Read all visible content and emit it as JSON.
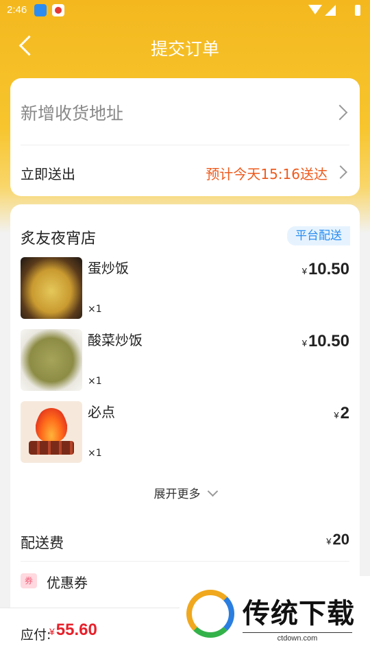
{
  "status_bar": {
    "time": "2:46"
  },
  "header": {
    "title": "提交订单"
  },
  "address_card": {
    "add_address_label": "新增收货地址",
    "delivery_mode_label": "立即送出",
    "delivery_estimate": "预计今天15:16送达"
  },
  "order": {
    "shop_name": "炙友夜宵店",
    "delivery_tag": "平台配送",
    "currency": "¥",
    "items": [
      {
        "name": "蛋炒饭",
        "qty": "×1",
        "price": "10.50"
      },
      {
        "name": "酸菜炒饭",
        "qty": "×1",
        "price": "10.50"
      },
      {
        "name": "必点",
        "qty": "×1",
        "price": "2"
      }
    ],
    "expand_label": "展开更多",
    "delivery_fee_label": "配送费",
    "delivery_fee": "20",
    "coupon_icon_text": "券",
    "coupon_label": "优惠券"
  },
  "footer": {
    "payable_label": "应付:",
    "payable_amount": "55.60"
  },
  "watermark": {
    "title": "传统下载",
    "site": "ctdown.com"
  },
  "colors": {
    "primary": "#f4b81e",
    "accent_orange": "#ee5a1c",
    "price_red": "#e8202a",
    "tag_blue": "#2b8ef0"
  }
}
